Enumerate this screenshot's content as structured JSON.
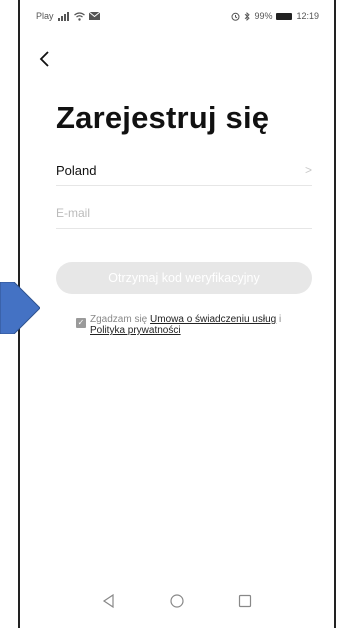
{
  "status_bar": {
    "left_text": "Play",
    "time": "12:19",
    "battery_percent": "99%"
  },
  "page": {
    "title": "Zarejestruj się"
  },
  "form": {
    "country_value": "Poland",
    "country_chevron": ">",
    "email_placeholder": "E-mail",
    "email_value": "",
    "submit_label": "Otrzymaj kod weryfikacyjny"
  },
  "agreement": {
    "checked": true,
    "prefix": "Zgadzam się ",
    "link1": "Umowa o świadczeniu usług",
    "separator": " i ",
    "link2": "Polityka prywatności"
  },
  "colors": {
    "arrow": "#4472c4",
    "button_disabled": "#e7e7e7"
  },
  "icons": {
    "back": "back-chevron-icon",
    "nav_back": "triangle-back-icon",
    "nav_home": "circle-home-icon",
    "nav_recent": "square-recent-icon"
  }
}
